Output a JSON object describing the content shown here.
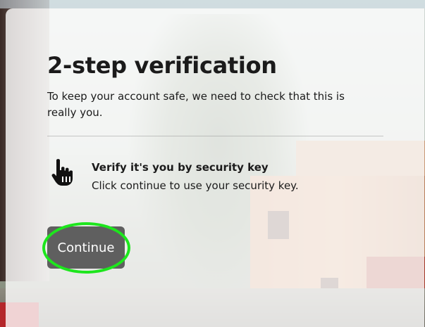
{
  "dialog": {
    "title": "2-step verification",
    "description": "To keep your account safe, we need to check that this is really you."
  },
  "method": {
    "icon": "hand-pointer-icon",
    "title": "Verify it's you by security key",
    "subtitle": "Click continue to use your security key."
  },
  "actions": {
    "continue_label": "Continue"
  },
  "colors": {
    "button_bg": "#5f5f5f",
    "highlight": "#1de61d",
    "text": "#1b1b1b"
  }
}
